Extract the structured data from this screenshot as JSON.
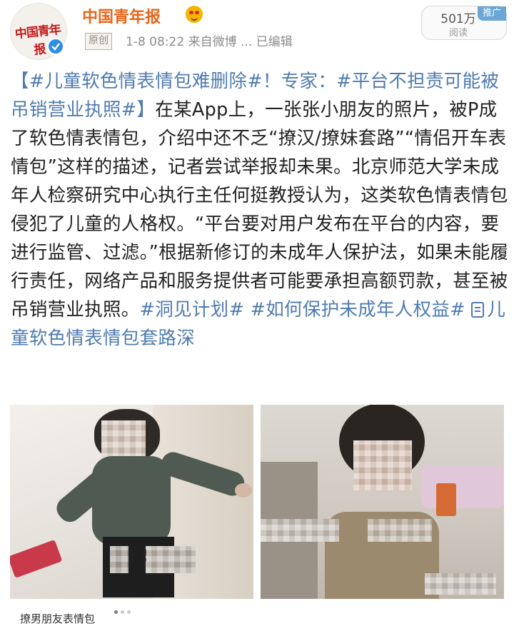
{
  "account": {
    "name": "中国青年报",
    "avatar_text": "中国青年报",
    "original_badge": "原创",
    "meta": "1-8 08:22  来自微博 ...  已编辑",
    "reads_count": "501万",
    "reads_label": "阅读",
    "promo_badge": "推广"
  },
  "post": {
    "headline_tag": "【#儿童软色情表情包难删除#！专家：#平台不担责可能被吊销营业执照#】",
    "body": "在某App上，一张张小朋友的照片，被P成了软色情表情包，介绍中还不乏“撩汉/撩妹套路”“情侣开车表情包”这样的描述，记者尝试举报却未果。北京师范大学未成年人检察研究中心执行主任何挺教授认为，这类软色情表情包侵犯了儿童的人格权。“平台要对用户发布在平台的内容，要进行监管、过滤。”根据新修订的未成年人保护法，如果未能履行责任，网络产品和服务提供者可能要承担高额罚款，甚至被吊销营业执照。",
    "tag_1": "#洞见计划#",
    "tag_2": "#如何保护未成年人权益#",
    "link_text": "儿童软色情表情包套路深"
  },
  "images": {
    "left_caption": "!          !",
    "bottom_text": "撩男朋友表情包"
  },
  "colors": {
    "accent_orange": "#e8651a",
    "link_blue": "#4f7bb0",
    "verified_blue": "#2f8de4"
  },
  "icons": [
    "verified-icon",
    "emoji-badge-icon",
    "doc-link-icon"
  ]
}
